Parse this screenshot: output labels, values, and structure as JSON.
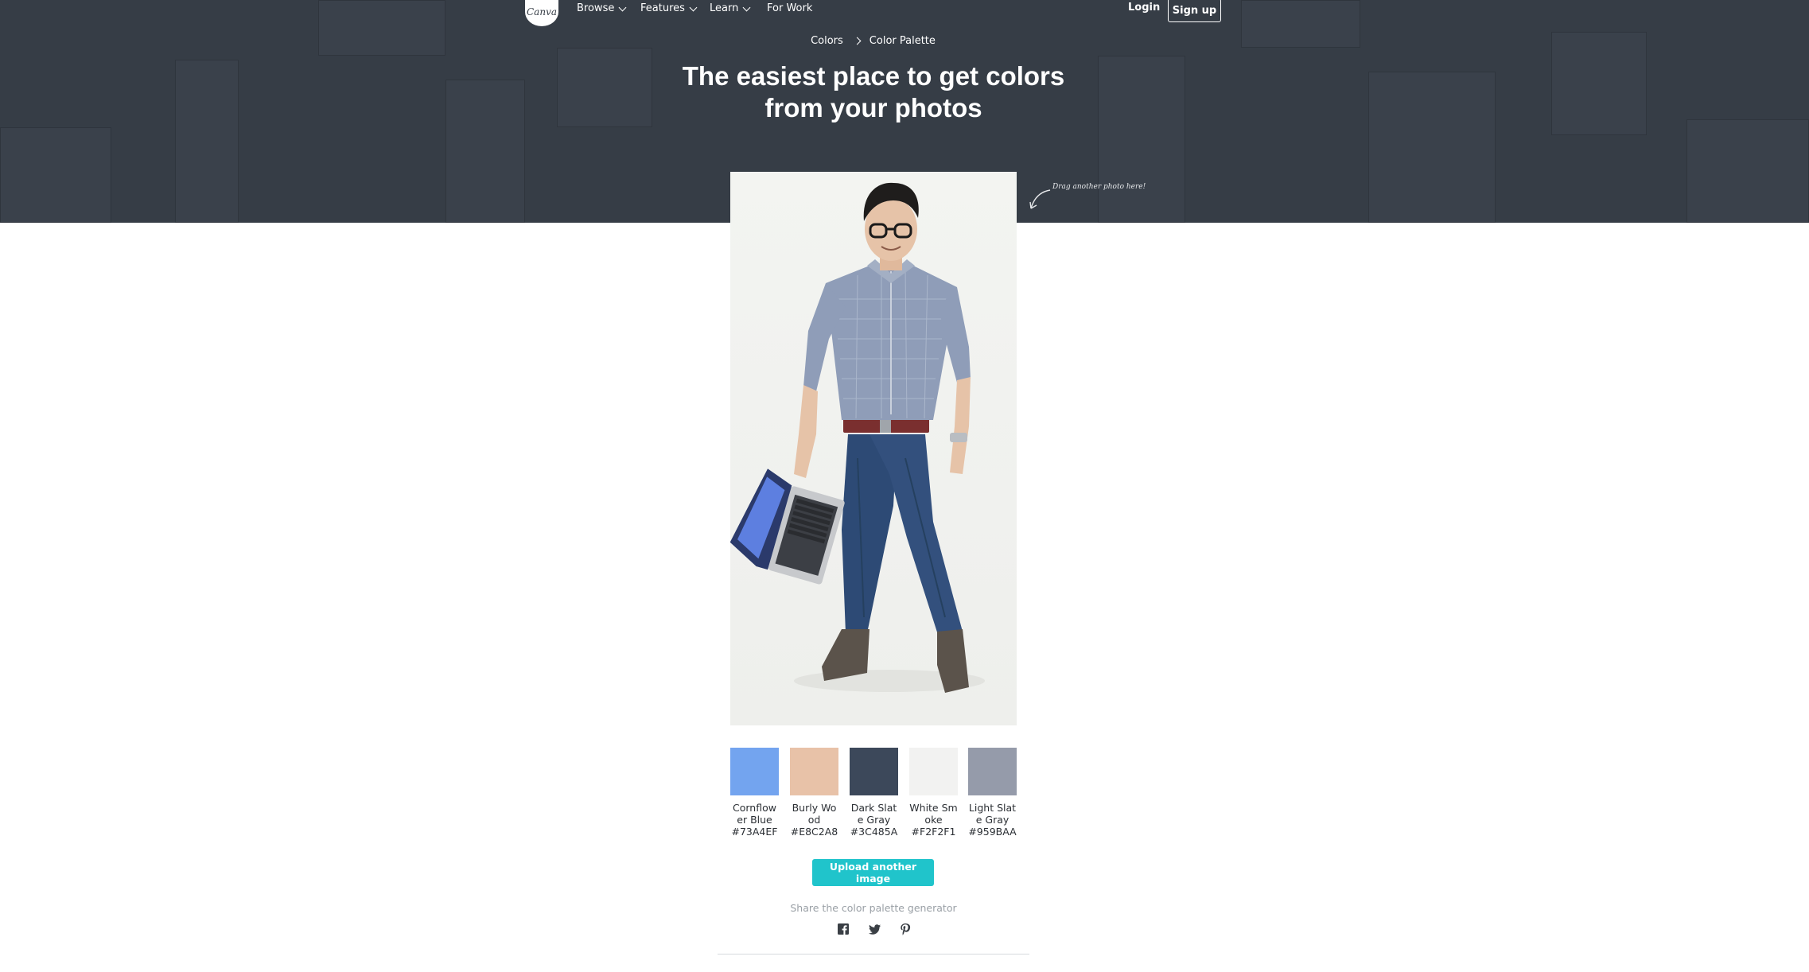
{
  "nav": {
    "logo_text": "Canva",
    "items": [
      {
        "label": "Browse",
        "has_dropdown": true
      },
      {
        "label": "Features",
        "has_dropdown": true
      },
      {
        "label": "Learn",
        "has_dropdown": true
      },
      {
        "label": "For Work",
        "has_dropdown": false
      }
    ],
    "login": "Login",
    "signup": "Sign up"
  },
  "breadcrumb": {
    "parent": "Colors",
    "current": "Color Palette"
  },
  "hero": {
    "headline": "The easiest place to get colors from your photos",
    "drag_hint": "Drag another photo here!"
  },
  "palette": [
    {
      "name": "Cornflower Blue",
      "hex": "#73A4EF"
    },
    {
      "name": "Burly Wood",
      "hex": "#E8C2A8"
    },
    {
      "name": "Dark Slate Gray",
      "hex": "#3C485A"
    },
    {
      "name": "White Smoke",
      "hex": "#F2F2F1"
    },
    {
      "name": "Light Slate Gray",
      "hex": "#959BAA"
    }
  ],
  "upload_button": "Upload another image",
  "share": {
    "label": "Share the color palette generator",
    "icons": [
      "facebook-icon",
      "twitter-icon",
      "pinterest-icon"
    ]
  },
  "colors": {
    "hero_bg": "#363d46",
    "accent": "#20c4cb"
  }
}
